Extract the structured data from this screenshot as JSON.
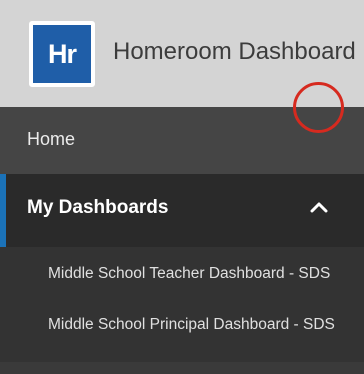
{
  "header": {
    "logo_text": "Hr",
    "title": "Homeroom Dashboard"
  },
  "sidebar": {
    "home_label": "Home",
    "my_dashboards_label": "My Dashboards",
    "toggle_icon": "chevron-up-icon",
    "items": [
      {
        "label": "Middle School Teacher Dashboard - SDS"
      },
      {
        "label": "Middle School Principal Dashboard - SDS"
      }
    ]
  },
  "colors": {
    "accent": "#1b72b8",
    "logo_bg": "#1f5ea8",
    "highlight_circle": "#d62a1f"
  }
}
